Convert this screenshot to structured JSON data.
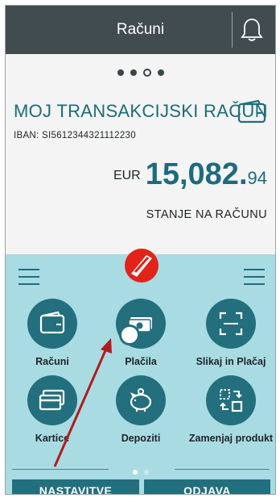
{
  "header": {
    "title": "Računi"
  },
  "account": {
    "title": "MOJ TRANSAKCIJSKI RAČUN",
    "iban_label": "IBAN:",
    "iban_value": "SI5612344321112230",
    "currency": "EUR",
    "balance_main": "15,082.",
    "balance_decimals": "94",
    "balance_label": "STANJE NA RAČUNU"
  },
  "carousel": {
    "total": 4,
    "active": 3
  },
  "tiles": [
    {
      "label": "Računi",
      "icon": "wallet-icon"
    },
    {
      "label": "Plačila",
      "icon": "money-icon"
    },
    {
      "label": "Slikaj in Plačaj",
      "icon": "scan-icon"
    },
    {
      "label": "Kartice",
      "icon": "cards-icon"
    },
    {
      "label": "Depoziti",
      "icon": "piggy-bank-icon"
    },
    {
      "label": "Zamenjaj produkt",
      "icon": "swap-icon"
    }
  ],
  "footer": {
    "settings_label": "NASTAVITVE",
    "logout_label": "ODJAVA"
  },
  "colors": {
    "header": "#414c50",
    "accent": "#236f7d",
    "panel": "#a9dbe3",
    "arrow": "#b01c1c"
  }
}
